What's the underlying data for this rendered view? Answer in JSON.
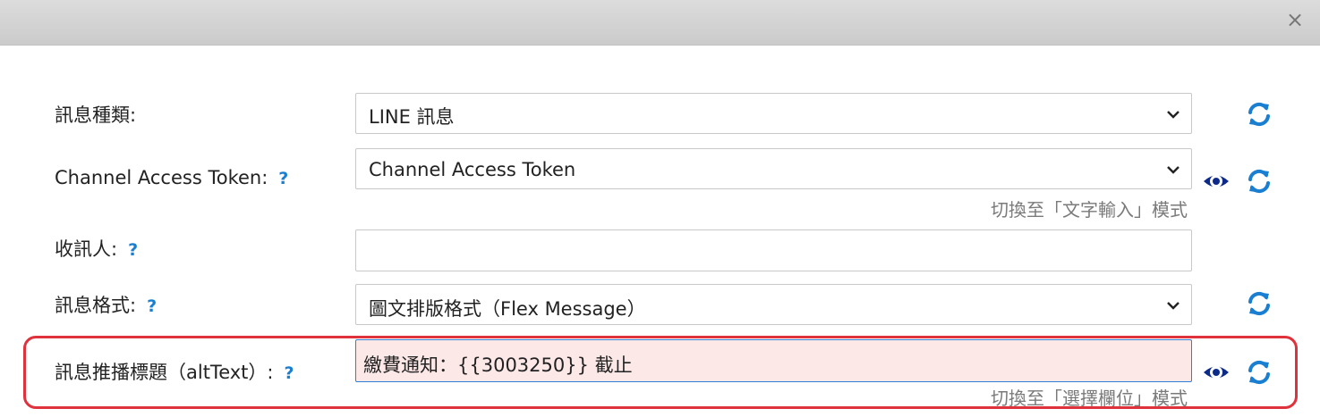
{
  "dialog": {
    "close_label": "×"
  },
  "fields": [
    {
      "label": "訊息種類:",
      "value": "LINE 訊息"
    },
    {
      "label": "Channel Access Token:",
      "help": "?",
      "value": "Channel Access Token",
      "hint": "切換至「文字輸入」模式"
    },
    {
      "label": "收訊人:",
      "help": "?",
      "value": ""
    },
    {
      "label": "訊息格式:",
      "help": "?",
      "value": "圖文排版格式（Flex Message）"
    },
    {
      "label": "訊息推播標題（altText）:",
      "help": "?",
      "value": "繳費通知：{{3003250}} 截止",
      "hint": "切換至「選擇欄位」模式"
    }
  ],
  "colors": {
    "accent": "#1a7fd1",
    "eye_icon": "#0b2a8a",
    "highlight_border": "#e0323d",
    "alt_input_bg": "#fde8e8"
  },
  "icons": [
    "refresh-icon",
    "eye-icon",
    "chevron-down-icon",
    "close-icon"
  ]
}
